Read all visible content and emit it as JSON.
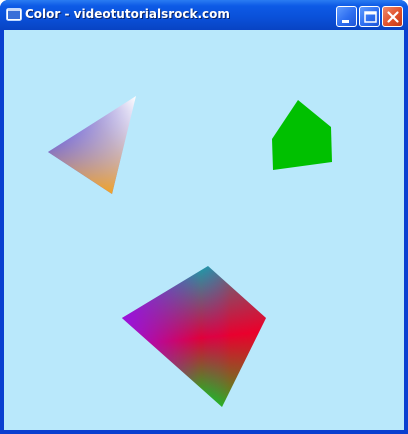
{
  "window": {
    "title": "Color - videotutorialsrock.com"
  },
  "controls": {
    "minimize": "minimize",
    "maximize": "maximize",
    "close": "close"
  },
  "scene": {
    "background": "#b9e8fb",
    "shapes": [
      {
        "name": "gradient-triangle",
        "colors": [
          "#1b1bf0",
          "#ffffff",
          "#f3a21f"
        ]
      },
      {
        "name": "green-pentagon",
        "colors": [
          "#00c000"
        ]
      },
      {
        "name": "gradient-quad",
        "colors": [
          "#1e9aa8",
          "#e8002a",
          "#00d61e",
          "#9b10e0"
        ]
      }
    ]
  }
}
